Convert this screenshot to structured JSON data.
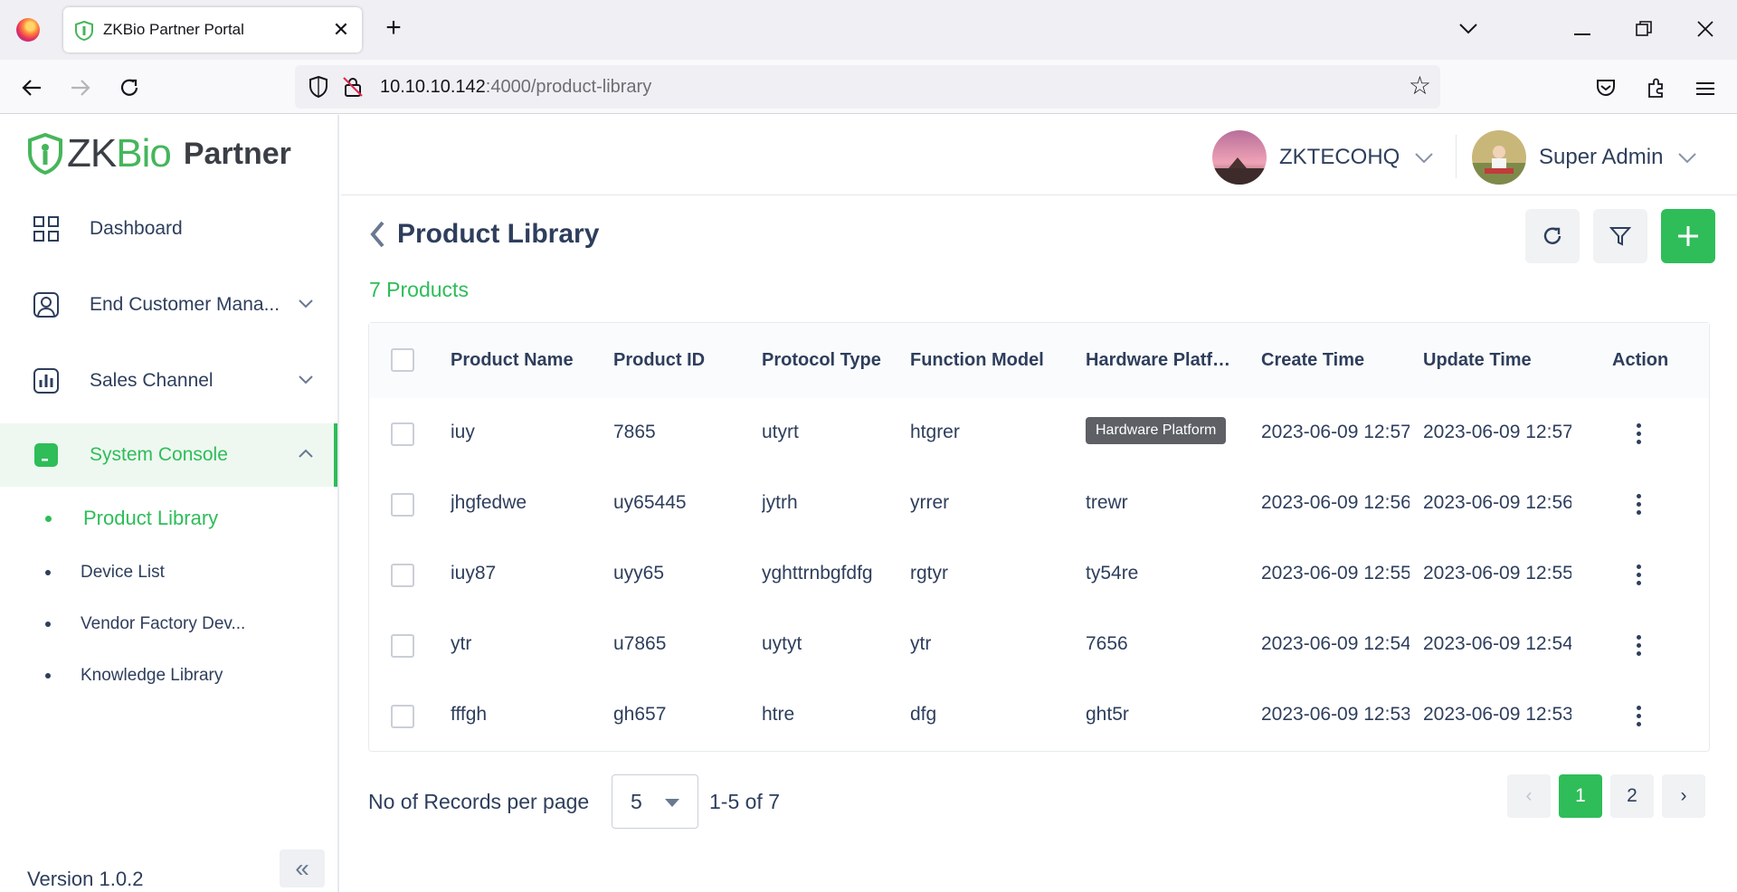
{
  "browser": {
    "tab_title": "ZKBio Partner Portal",
    "tab_close": "✕",
    "new_tab": "+",
    "url_host": "10.10.10.142",
    "url_path": ":4000/product-library"
  },
  "brand": {
    "zk": "ZK",
    "bio": "Bio",
    "partner": "Partner"
  },
  "sidebar": {
    "items": [
      {
        "label": "Dashboard",
        "icon": "grid-icon"
      },
      {
        "label": "End Customer Mana...",
        "icon": "user-square-icon"
      },
      {
        "label": "Sales Channel",
        "icon": "bar-chart-icon"
      },
      {
        "label": "System Console",
        "icon": "console-icon"
      }
    ],
    "sub_items": [
      {
        "label": "Product Library"
      },
      {
        "label": "Device List"
      },
      {
        "label": "Vendor Factory Dev..."
      },
      {
        "label": "Knowledge Library"
      }
    ],
    "version": "Version 1.0.2",
    "collapse": "«"
  },
  "topbar": {
    "company": "ZKTECOHQ",
    "user": "Super Admin"
  },
  "page": {
    "title": "Product Library",
    "count": "7 Products"
  },
  "table": {
    "columns": [
      "Product Name",
      "Product ID",
      "Protocol Type",
      "Function Model",
      "Hardware Platf…",
      "Create Time",
      "Update Time",
      "Action"
    ],
    "rows": [
      [
        "iuy",
        "7865",
        "utyrt",
        "htgrer",
        "",
        "2023-06-09 12:57",
        "2023-06-09 12:57"
      ],
      [
        "jhgfedwe",
        "uy65445",
        "jytrh",
        "yrrer",
        "trewr",
        "2023-06-09 12:56",
        "2023-06-09 12:56"
      ],
      [
        "iuy87",
        "uyy65",
        "yghttrnbgfdfg",
        "rgtyr",
        "ty54re",
        "2023-06-09 12:55",
        "2023-06-09 12:55"
      ],
      [
        "ytr",
        "u7865",
        "uytyt",
        "ytr",
        "7656",
        "2023-06-09 12:54",
        "2023-06-09 12:54"
      ],
      [
        "fffgh",
        "gh657",
        "htre",
        "dfg",
        "ght5r",
        "2023-06-09 12:53",
        "2023-06-09 12:53"
      ]
    ],
    "tooltip": "Hardware Platform"
  },
  "pagination": {
    "rpp_label": "No of Records per page",
    "rpp_value": "5",
    "range": "1-5 of 7",
    "prev": "‹",
    "pages": [
      "1",
      "2"
    ],
    "next": "›"
  },
  "colors": {
    "accent": "#2ebd59",
    "text": "#2e3e5c"
  }
}
